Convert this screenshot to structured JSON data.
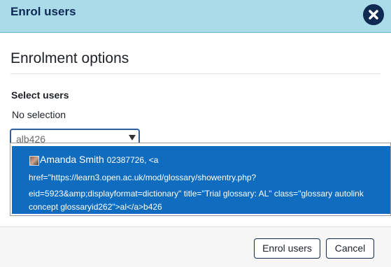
{
  "modal": {
    "title": "Enrol users",
    "close_icon": "close-icon"
  },
  "section": {
    "title": "Enrolment options"
  },
  "select_users": {
    "label": "Select users",
    "selection_status": "No selection",
    "search_value": "alb426",
    "dropdown_icon": "caret-down-icon"
  },
  "suggestion": {
    "name": "Amanda Smith",
    "id_text": "02387726, <a",
    "line2": "href=\"https://learn3.open.ac.uk/mod/glossary/showentry.php?",
    "line3": "eid=5923&amp;displayformat=dictionary\" title=\"Trial glossary: AL\" class=\"glossary autolink",
    "line4": "concept glossaryid262\">al</a>b426"
  },
  "footer": {
    "enrol_label": "Enrol users",
    "cancel_label": "Cancel"
  },
  "colors": {
    "header_bg": "#a9dbe8",
    "header_title": "#0d2a55",
    "suggestion_highlight": "#0f6cbf",
    "button_border": "#0f2a52"
  }
}
